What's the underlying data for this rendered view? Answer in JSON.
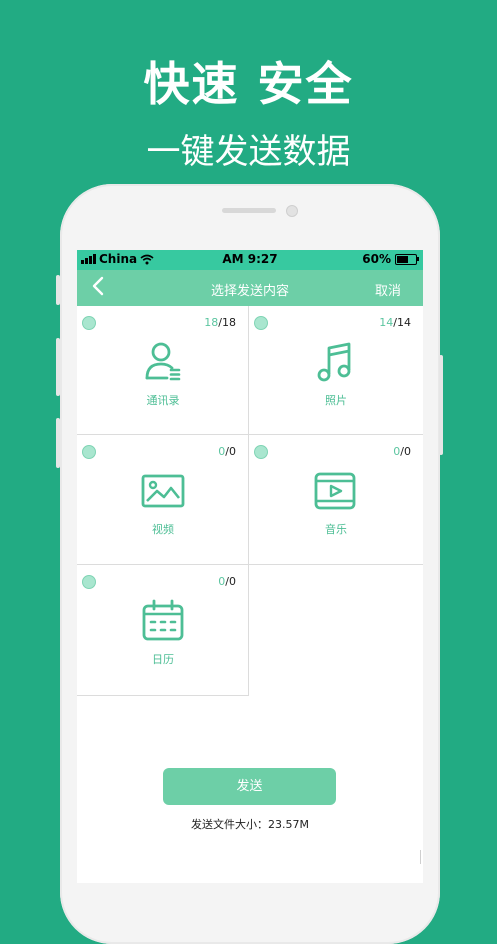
{
  "promo": {
    "headline": "快速 安全",
    "subheadline": "一键发送数据"
  },
  "status_bar": {
    "carrier": "China",
    "time": "AM 9:27",
    "battery": "60%",
    "battery_level": 0.6
  },
  "nav": {
    "title": "选择发送内容",
    "cancel": "取消",
    "back_icon": "chevron-left-icon"
  },
  "items": [
    {
      "label": "通讯录",
      "selected": "18",
      "total": "/18",
      "icon": "contacts-icon"
    },
    {
      "label": "照片",
      "selected": "14",
      "total": "/14",
      "icon": "music-note-icon"
    },
    {
      "label": "视频",
      "selected": "0",
      "total": "/0",
      "icon": "image-icon"
    },
    {
      "label": "音乐",
      "selected": "0",
      "total": "/0",
      "icon": "video-play-icon"
    },
    {
      "label": "日历",
      "selected": "0",
      "total": "/0",
      "icon": "calendar-icon"
    }
  ],
  "actions": {
    "send": "发送",
    "size_info": "发送文件大小：23.57M"
  },
  "colors": {
    "background": "#22ab83",
    "status_bar": "#37c9a0",
    "nav_bar": "#6dcfa7",
    "accent": "#4dbe95",
    "send_button": "#6dcfa7"
  }
}
